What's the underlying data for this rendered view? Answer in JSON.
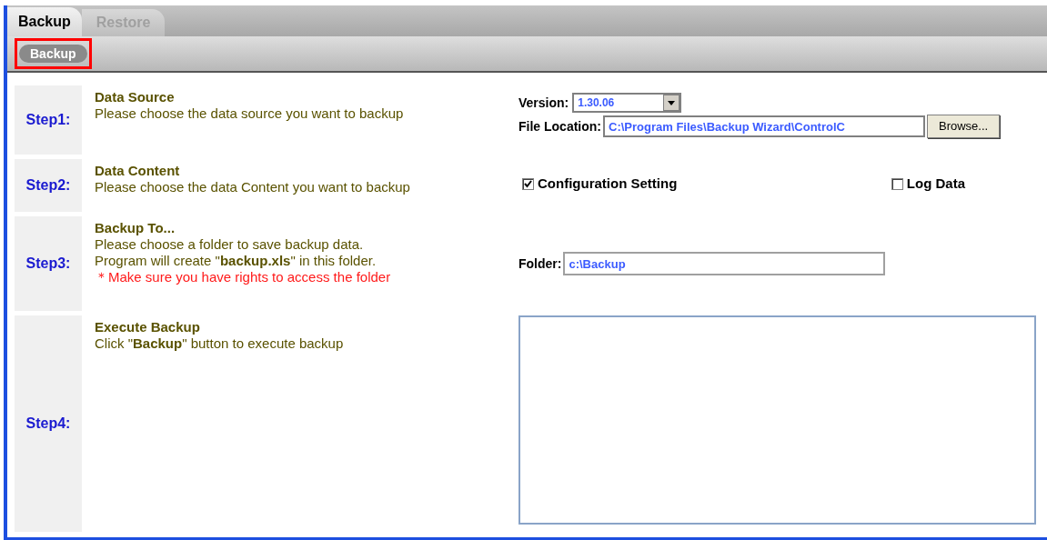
{
  "tabs": [
    {
      "label": "Backup",
      "selected": true
    },
    {
      "label": "Restore",
      "selected": false
    }
  ],
  "toolbar": {
    "button": "Backup",
    "highlighted": true
  },
  "steps": [
    {
      "label": "Step1:",
      "title": "Data Source",
      "lines": [
        {
          "text": "Please choose the data source you want to backup",
          "kind": "normal"
        }
      ]
    },
    {
      "label": "Step2:",
      "title": "Data Content",
      "lines": [
        {
          "text": "Please choose the data Content you want to backup",
          "kind": "normal"
        }
      ]
    },
    {
      "label": "Step3:",
      "title": "Backup To...",
      "lines": [
        {
          "text": "Please choose a folder to save backup data.",
          "kind": "normal"
        },
        {
          "text": "Program will create \"**backup.xls**\" in this folder.",
          "kind": "normal"
        },
        {
          "text": "＊Make sure you have rights to access the folder",
          "kind": "warning"
        }
      ]
    },
    {
      "label": "Step4:",
      "title": "Execute Backup",
      "lines": [
        {
          "text": "Click \"**Backup**\" button to execute backup",
          "kind": "normal"
        }
      ]
    }
  ],
  "version": {
    "label": "Version:",
    "value": "1.30.06"
  },
  "file_location": {
    "label": "File Location:",
    "value": "C:\\Program Files\\Backup Wizard\\ControlC",
    "button": "Browse..."
  },
  "content_options": [
    {
      "label": "Configuration Setting",
      "checked": true
    },
    {
      "label": "Log Data",
      "checked": false
    }
  ],
  "folder": {
    "label": "Folder:",
    "value": "c:\\Backup"
  }
}
